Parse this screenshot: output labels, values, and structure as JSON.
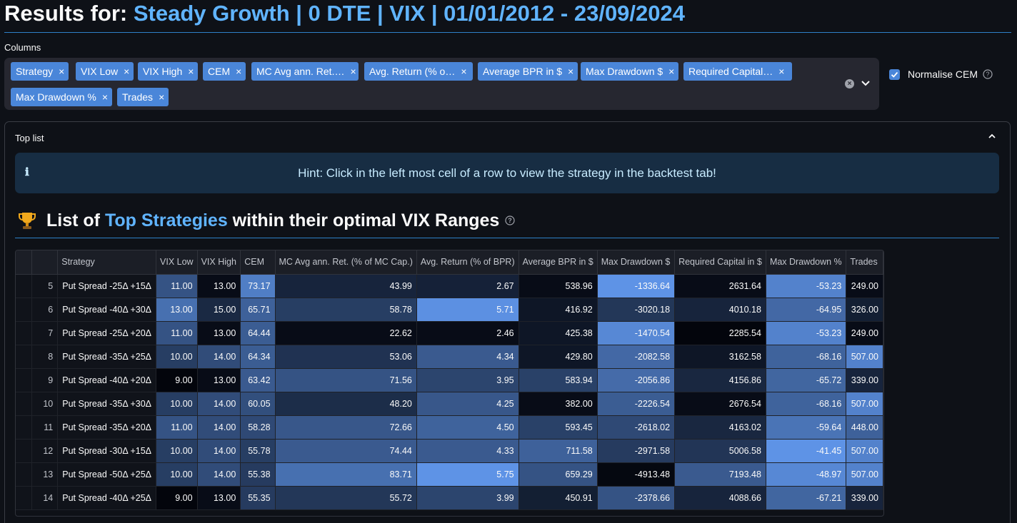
{
  "header": {
    "title_prefix": "Results for:",
    "title_accent": "Steady Growth | 0 DTE | VIX | 01/01/2012 - 23/09/2024"
  },
  "columns_select": {
    "label": "Columns",
    "chips": [
      {
        "label": "Strategy"
      },
      {
        "label": "VIX Low"
      },
      {
        "label": "VIX High"
      },
      {
        "label": "CEM"
      },
      {
        "label": "MC Avg ann. Ret.…"
      },
      {
        "label": "Avg. Return (% o…"
      },
      {
        "label": "Average BPR in $"
      },
      {
        "label": "Max Drawdown $"
      },
      {
        "label": "Required Capital…"
      },
      {
        "label": "Max Drawdown %"
      },
      {
        "label": "Trades"
      }
    ],
    "remove_glyph": "×"
  },
  "normalise": {
    "label": "Normalise CEM",
    "checked": true
  },
  "top_list": {
    "title": "Top list",
    "hint": "Hint: Click in the left most cell of a row to view the strategy in the backtest tab!",
    "hint_icon": "ℹ",
    "heading_prefix": "List of ",
    "heading_accent": "Top Strategies",
    "heading_suffix": " within their optimal VIX Ranges"
  },
  "table": {
    "headers": [
      "",
      "",
      "Strategy",
      "VIX Low",
      "VIX High",
      "CEM",
      "MC Avg ann. Ret. (% of MC Cap.)",
      "Avg. Return (% of BPR)",
      "Average BPR in $",
      "Max Drawdown $",
      "Required Capital in $",
      "Max Drawdown %",
      "Trades"
    ],
    "rows": [
      {
        "idx": "5",
        "cells": [
          "Put Spread -25Δ +15Δ",
          "11.00",
          "13.00",
          "73.17",
          "43.99",
          "2.67",
          "538.96",
          "-1336.64",
          "2631.64",
          "-53.23",
          "249.00"
        ]
      },
      {
        "idx": "6",
        "cells": [
          "Put Spread -40Δ +30Δ",
          "13.00",
          "15.00",
          "65.71",
          "58.78",
          "5.71",
          "416.92",
          "-3020.18",
          "4010.18",
          "-64.95",
          "326.00"
        ]
      },
      {
        "idx": "7",
        "cells": [
          "Put Spread -25Δ +20Δ",
          "11.00",
          "13.00",
          "64.44",
          "22.62",
          "2.46",
          "425.38",
          "-1470.54",
          "2285.54",
          "-53.23",
          "249.00"
        ]
      },
      {
        "idx": "8",
        "cells": [
          "Put Spread -35Δ +25Δ",
          "10.00",
          "14.00",
          "64.34",
          "53.06",
          "4.34",
          "429.80",
          "-2082.58",
          "3162.58",
          "-68.16",
          "507.00"
        ]
      },
      {
        "idx": "9",
        "cells": [
          "Put Spread -40Δ +20Δ",
          "9.00",
          "13.00",
          "63.42",
          "71.56",
          "3.95",
          "583.94",
          "-2056.86",
          "4156.86",
          "-65.72",
          "339.00"
        ]
      },
      {
        "idx": "10",
        "cells": [
          "Put Spread -35Δ +30Δ",
          "10.00",
          "14.00",
          "60.05",
          "48.20",
          "4.25",
          "382.00",
          "-2226.54",
          "2676.54",
          "-68.16",
          "507.00"
        ]
      },
      {
        "idx": "11",
        "cells": [
          "Put Spread -35Δ +20Δ",
          "11.00",
          "14.00",
          "58.28",
          "72.66",
          "4.50",
          "593.45",
          "-2618.02",
          "4163.02",
          "-59.64",
          "448.00"
        ]
      },
      {
        "idx": "12",
        "cells": [
          "Put Spread -30Δ +15Δ",
          "10.00",
          "14.00",
          "55.78",
          "74.44",
          "4.33",
          "711.58",
          "-2971.58",
          "5006.58",
          "-41.45",
          "507.00"
        ]
      },
      {
        "idx": "13",
        "cells": [
          "Put Spread -50Δ +25Δ",
          "10.00",
          "14.00",
          "55.38",
          "83.71",
          "5.75",
          "659.29",
          "-4913.48",
          "7193.48",
          "-48.97",
          "507.00"
        ]
      },
      {
        "idx": "14",
        "cells": [
          "Put Spread -40Δ +25Δ",
          "9.00",
          "13.00",
          "55.35",
          "55.72",
          "3.99",
          "450.91",
          "-2378.66",
          "4088.66",
          "-67.21",
          "339.00"
        ]
      }
    ],
    "shades": [
      [
        null,
        0.55,
        0.05,
        0.85,
        0.22,
        0.2,
        0.05,
        1.0,
        0.05,
        0.88,
        0.05
      ],
      [
        null,
        0.75,
        0.25,
        0.65,
        0.4,
        0.98,
        0.12,
        0.35,
        0.22,
        0.7,
        0.18
      ],
      [
        null,
        0.55,
        0.05,
        0.62,
        0.05,
        0.05,
        0.12,
        0.92,
        0.0,
        0.88,
        0.05
      ],
      [
        null,
        0.4,
        0.5,
        0.62,
        0.32,
        0.6,
        0.12,
        0.7,
        0.12,
        0.66,
        0.88
      ],
      [
        null,
        0.0,
        0.05,
        0.6,
        0.55,
        0.45,
        0.42,
        0.72,
        0.24,
        0.68,
        0.22
      ],
      [
        null,
        0.4,
        0.5,
        0.52,
        0.28,
        0.58,
        0.05,
        0.62,
        0.05,
        0.66,
        0.88
      ],
      [
        null,
        0.55,
        0.5,
        0.48,
        0.58,
        0.66,
        0.42,
        0.48,
        0.24,
        0.78,
        0.65
      ],
      [
        null,
        0.4,
        0.5,
        0.4,
        0.6,
        0.6,
        0.65,
        0.38,
        0.34,
        1.0,
        0.88
      ],
      [
        null,
        0.4,
        0.5,
        0.38,
        0.75,
        1.0,
        0.55,
        0.02,
        0.6,
        0.92,
        0.88
      ],
      [
        null,
        0.0,
        0.05,
        0.38,
        0.35,
        0.45,
        0.18,
        0.55,
        0.22,
        0.68,
        0.22
      ]
    ],
    "color_scale": {
      "low": "#03050c",
      "high": "#5e93e6"
    }
  }
}
